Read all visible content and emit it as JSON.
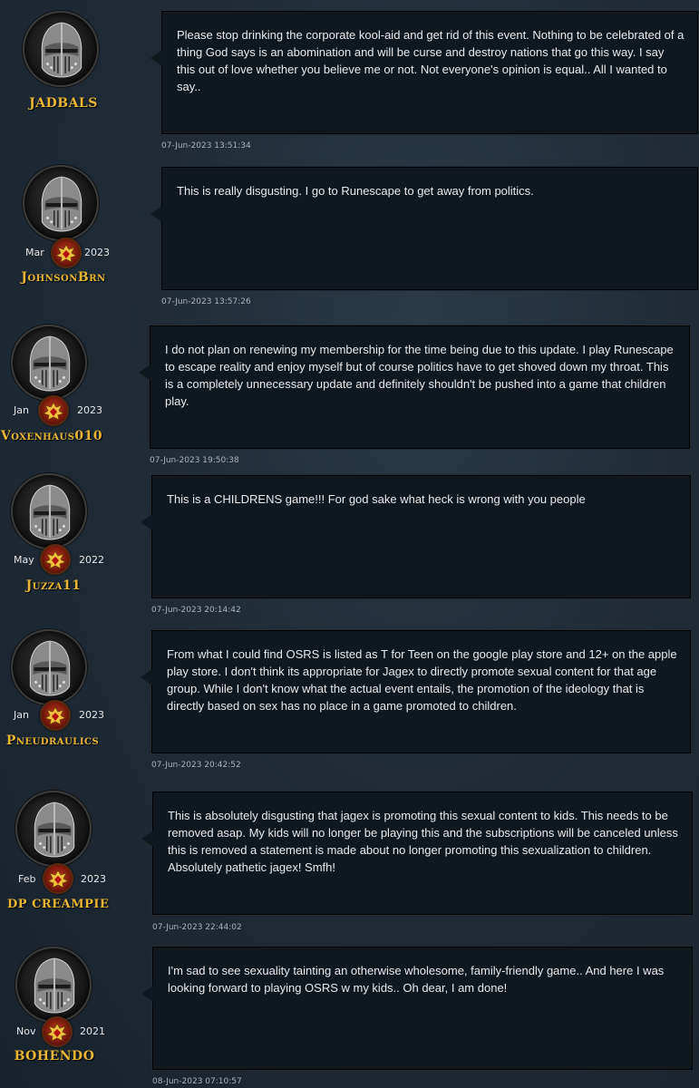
{
  "posts": [
    {
      "username": "JADBALS",
      "month": "",
      "year": "",
      "text": "Please stop drinking the corporate kool-aid and get rid of this event. Nothing to be celebrated of a thing God says is an abomination and will be curse and destroy nations that go this way. I say this out of love whether you believe me or not. Not everyone's opinion is equal.. All I wanted to say..",
      "timestamp": "07-Jun-2023 13:51:34"
    },
    {
      "username": "JohnsonBrn",
      "month": "Mar",
      "year": "2023",
      "text": "This is really disgusting. I go to Runescape to get away from politics.",
      "timestamp": "07-Jun-2023 13:57:26"
    },
    {
      "username": "Voxenhaus010",
      "month": "Jan",
      "year": "2023",
      "text": "I do not plan on renewing my membership for the time being due to this update. I play Runescape to escape reality and enjoy myself but of course politics have to get shoved down my throat. This is a completely unnecessary update and definitely shouldn't be pushed into a game that children play.",
      "timestamp": "07-Jun-2023 19:50:38"
    },
    {
      "username": "Juzza11",
      "month": "May",
      "year": "2022",
      "text": "This is a CHILDRENS game!!! For god sake what heck is wrong with you people",
      "timestamp": "07-Jun-2023 20:14:42"
    },
    {
      "username": "Pneudraulics",
      "month": "Jan",
      "year": "2023",
      "text": "From what I could find OSRS is listed as T for Teen on the google play store and 12+ on the apple play store. I don't think its appropriate for Jagex to directly promote sexual content for that age group. While I don't know what the actual event entails, the promotion of the ideology that is directly based on sex has no place in a game promoted to children.",
      "timestamp": "07-Jun-2023 20:42:52"
    },
    {
      "username": "DP CREAMPIE",
      "month": "Feb",
      "year": "2023",
      "text": "This is absolutely disgusting that jagex is promoting this sexual content to kids. This needs to be removed asap. My kids will no longer be playing this and the subscriptions will be canceled unless this is removed a statement is made about no longer promoting this sexualization to children. Absolutely pathetic jagex! Smfh!",
      "timestamp": "07-Jun-2023 22:44:02"
    },
    {
      "username": "BOHENDO",
      "month": "Nov",
      "year": "2021",
      "text": "I'm sad to see sexuality tainting an otherwise wholesome, family-friendly game.. And here I was looking forward to playing OSRS w my kids.. Oh dear, I am done!",
      "timestamp": "08-Jun-2023 07:10:57"
    }
  ],
  "icons": {
    "avatar": "helmet-avatar-icon",
    "badge": "membership-crest-icon"
  },
  "colors": {
    "username": "#e8b634",
    "bubble": "#0f171f",
    "text": "#eaeaea",
    "timestamp": "#a9b2ba"
  }
}
